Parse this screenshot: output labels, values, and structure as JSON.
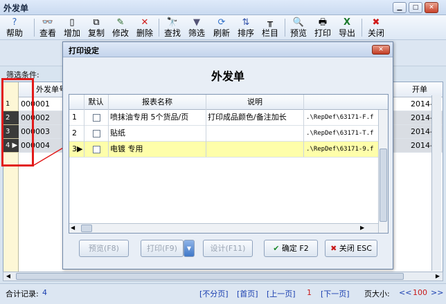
{
  "window": {
    "title": "外发单"
  },
  "toolbar": {
    "items": [
      {
        "label": "帮助",
        "icon": "help-icon"
      },
      {
        "label": "查看",
        "icon": "view-icon"
      },
      {
        "label": "增加",
        "icon": "add-icon"
      },
      {
        "label": "复制",
        "icon": "copy-icon"
      },
      {
        "label": "修改",
        "icon": "edit-icon"
      },
      {
        "label": "删除",
        "icon": "delete-icon"
      },
      {
        "label": "查找",
        "icon": "find-icon"
      },
      {
        "label": "筛选",
        "icon": "filter-icon"
      },
      {
        "label": "刷新",
        "icon": "refresh-icon"
      },
      {
        "label": "排序",
        "icon": "sort-icon"
      },
      {
        "label": "栏目",
        "icon": "columns-icon"
      },
      {
        "label": "预览",
        "icon": "preview-icon"
      },
      {
        "label": "打印",
        "icon": "print-icon"
      },
      {
        "label": "导出",
        "icon": "export-icon"
      },
      {
        "label": "关闭",
        "icon": "close-icon"
      }
    ]
  },
  "filter": {
    "label": "筛选条件:"
  },
  "grid": {
    "columns": [
      "外发单号",
      "开单"
    ],
    "rows": [
      {
        "num": "1",
        "no": "000001",
        "date": "2014-"
      },
      {
        "num": "2",
        "no": "000002",
        "date": "2014-"
      },
      {
        "num": "3",
        "no": "000003",
        "date": "2014-"
      },
      {
        "num": "4",
        "no": "000004",
        "date": "2014-"
      }
    ]
  },
  "status": {
    "total_label": "合计记录:",
    "total_value": "4",
    "no_page": "[不分页]",
    "first": "[首页]",
    "prev": "[上一页]",
    "page": "1",
    "next": "[下一页]",
    "page_size_label": "页大小:",
    "page_size": "100"
  },
  "dialog": {
    "title": "打印设定",
    "heading": "外发单",
    "columns": [
      "默认",
      "报表名称",
      "说明",
      ""
    ],
    "rows": [
      {
        "num": "1",
        "name": "喷抹油专用 5个货品/页",
        "desc": "打印成品颜色/备注加长",
        "path": ".\\RepDef\\63171-F.f"
      },
      {
        "num": "2",
        "name": "贴纸",
        "desc": "",
        "path": ".\\RepDef\\63171-T.f"
      },
      {
        "num": "3",
        "name": "电镀  专用",
        "desc": "",
        "path": ".\\RepDef\\63171-9.f"
      }
    ],
    "buttons": {
      "preview": "预览(F8)",
      "print": "打印(F9)",
      "design": "设计(F11)",
      "ok": "确定 F2",
      "close": "关闭 ESC"
    }
  }
}
